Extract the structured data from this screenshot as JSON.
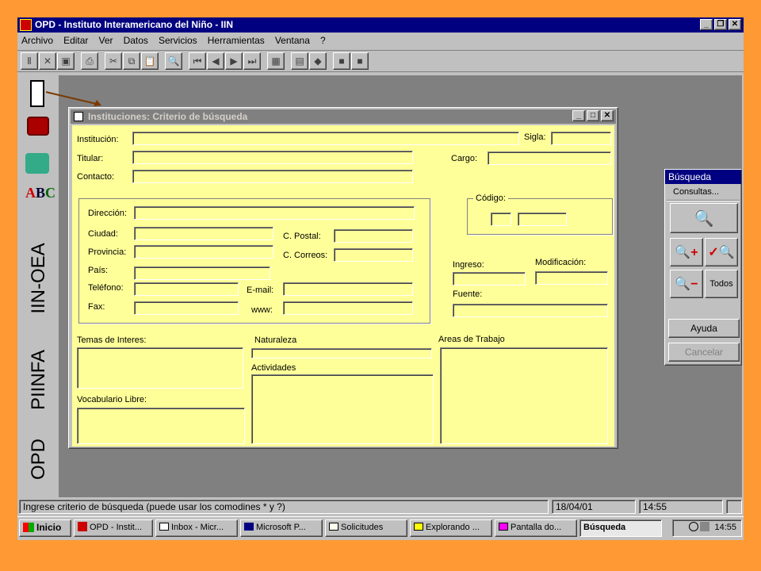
{
  "app": {
    "title": "OPD - Instituto Interamericano del Niño - IIN",
    "menu": [
      {
        "label": "Archivo"
      },
      {
        "label": "Editar"
      },
      {
        "label": "Ver"
      },
      {
        "label": "Datos"
      },
      {
        "label": "Servicios"
      },
      {
        "label": "Herramientas"
      },
      {
        "label": "Ventana"
      },
      {
        "label": "?"
      }
    ],
    "toolbar_icons": [
      "column-icon",
      "delete-icon",
      "save-icon",
      "print-icon",
      "cut-icon",
      "copy-icon",
      "paste-icon",
      "find-icon",
      "first-icon",
      "previous-icon",
      "next-icon",
      "last-icon",
      "table-icon",
      "form-icon",
      "diamond-icon",
      "square-icon",
      "square-icon"
    ]
  },
  "side_brand": {
    "text1": "IIN-OEA",
    "text2": "PIINFA",
    "text3": "OPD"
  },
  "dialog": {
    "title": "Instituciones: Criterio de búsqueda",
    "labels": {
      "institucion": "Institución:",
      "sigla": "Sigla:",
      "titular": "Titular:",
      "cargo": "Cargo:",
      "contacto": "Contacto:",
      "direccion": "Dirección:",
      "ciudad": "Ciudad:",
      "cpostal": "C. Postal:",
      "provincia": "Provincia:",
      "ccorreos": "C. Correos:",
      "pais": "País:",
      "telefono": "Teléfono:",
      "email": "E-mail:",
      "fax": "Fax:",
      "www": "www:",
      "codigo": "Código:",
      "ingreso": "Ingreso:",
      "modificacion": "Modificación:",
      "fuente": "Fuente:",
      "temas": "Temas de Interes:",
      "naturaleza": "Naturaleza",
      "actividades": "Actividades",
      "areas": "Areas de Trabajo",
      "vocabulario": "Vocabulario Libre:"
    }
  },
  "search_panel": {
    "title": "Búsqueda",
    "consultas": "Consultas...",
    "todos": "Todos",
    "ayuda": "Ayuda",
    "cancelar": "Cancelar"
  },
  "status": {
    "message": "Ingrese criterio de búsqueda (puede usar los comodines * y ?)",
    "date": "18/04/01",
    "time": "14:55"
  },
  "taskbar": {
    "start": "Inicio",
    "tasks": [
      {
        "label": "OPD - Instit..."
      },
      {
        "label": "Inbox - Micr..."
      },
      {
        "label": "Microsoft P..."
      },
      {
        "label": "Solicitudes"
      },
      {
        "label": "Explorando ..."
      },
      {
        "label": "Pantalla do..."
      },
      {
        "label": "Búsqueda"
      }
    ],
    "clock": "14:55"
  }
}
